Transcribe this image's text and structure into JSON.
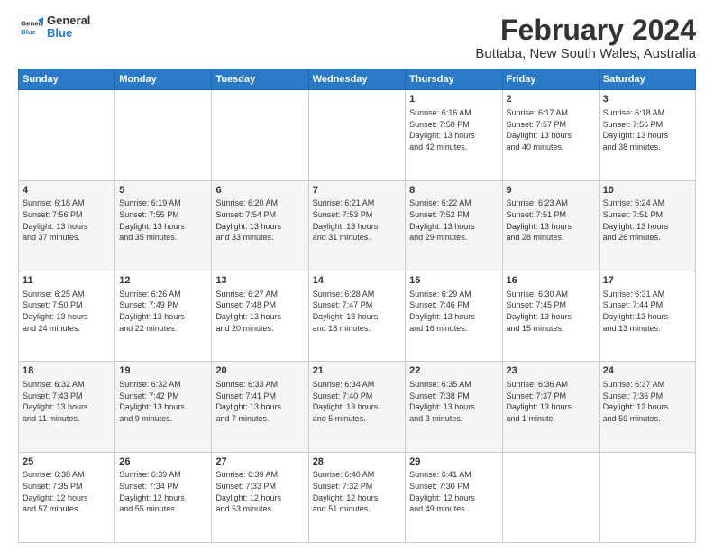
{
  "header": {
    "logo_line1": "General",
    "logo_line2": "Blue",
    "title": "February 2024",
    "subtitle": "Buttaba, New South Wales, Australia"
  },
  "days_of_week": [
    "Sunday",
    "Monday",
    "Tuesday",
    "Wednesday",
    "Thursday",
    "Friday",
    "Saturday"
  ],
  "weeks": [
    [
      {
        "day": "",
        "info": ""
      },
      {
        "day": "",
        "info": ""
      },
      {
        "day": "",
        "info": ""
      },
      {
        "day": "",
        "info": ""
      },
      {
        "day": "1",
        "info": "Sunrise: 6:16 AM\nSunset: 7:58 PM\nDaylight: 13 hours\nand 42 minutes."
      },
      {
        "day": "2",
        "info": "Sunrise: 6:17 AM\nSunset: 7:57 PM\nDaylight: 13 hours\nand 40 minutes."
      },
      {
        "day": "3",
        "info": "Sunrise: 6:18 AM\nSunset: 7:56 PM\nDaylight: 13 hours\nand 38 minutes."
      }
    ],
    [
      {
        "day": "4",
        "info": "Sunrise: 6:18 AM\nSunset: 7:56 PM\nDaylight: 13 hours\nand 37 minutes."
      },
      {
        "day": "5",
        "info": "Sunrise: 6:19 AM\nSunset: 7:55 PM\nDaylight: 13 hours\nand 35 minutes."
      },
      {
        "day": "6",
        "info": "Sunrise: 6:20 AM\nSunset: 7:54 PM\nDaylight: 13 hours\nand 33 minutes."
      },
      {
        "day": "7",
        "info": "Sunrise: 6:21 AM\nSunset: 7:53 PM\nDaylight: 13 hours\nand 31 minutes."
      },
      {
        "day": "8",
        "info": "Sunrise: 6:22 AM\nSunset: 7:52 PM\nDaylight: 13 hours\nand 29 minutes."
      },
      {
        "day": "9",
        "info": "Sunrise: 6:23 AM\nSunset: 7:51 PM\nDaylight: 13 hours\nand 28 minutes."
      },
      {
        "day": "10",
        "info": "Sunrise: 6:24 AM\nSunset: 7:51 PM\nDaylight: 13 hours\nand 26 minutes."
      }
    ],
    [
      {
        "day": "11",
        "info": "Sunrise: 6:25 AM\nSunset: 7:50 PM\nDaylight: 13 hours\nand 24 minutes."
      },
      {
        "day": "12",
        "info": "Sunrise: 6:26 AM\nSunset: 7:49 PM\nDaylight: 13 hours\nand 22 minutes."
      },
      {
        "day": "13",
        "info": "Sunrise: 6:27 AM\nSunset: 7:48 PM\nDaylight: 13 hours\nand 20 minutes."
      },
      {
        "day": "14",
        "info": "Sunrise: 6:28 AM\nSunset: 7:47 PM\nDaylight: 13 hours\nand 18 minutes."
      },
      {
        "day": "15",
        "info": "Sunrise: 6:29 AM\nSunset: 7:46 PM\nDaylight: 13 hours\nand 16 minutes."
      },
      {
        "day": "16",
        "info": "Sunrise: 6:30 AM\nSunset: 7:45 PM\nDaylight: 13 hours\nand 15 minutes."
      },
      {
        "day": "17",
        "info": "Sunrise: 6:31 AM\nSunset: 7:44 PM\nDaylight: 13 hours\nand 13 minutes."
      }
    ],
    [
      {
        "day": "18",
        "info": "Sunrise: 6:32 AM\nSunset: 7:43 PM\nDaylight: 13 hours\nand 11 minutes."
      },
      {
        "day": "19",
        "info": "Sunrise: 6:32 AM\nSunset: 7:42 PM\nDaylight: 13 hours\nand 9 minutes."
      },
      {
        "day": "20",
        "info": "Sunrise: 6:33 AM\nSunset: 7:41 PM\nDaylight: 13 hours\nand 7 minutes."
      },
      {
        "day": "21",
        "info": "Sunrise: 6:34 AM\nSunset: 7:40 PM\nDaylight: 13 hours\nand 5 minutes."
      },
      {
        "day": "22",
        "info": "Sunrise: 6:35 AM\nSunset: 7:38 PM\nDaylight: 13 hours\nand 3 minutes."
      },
      {
        "day": "23",
        "info": "Sunrise: 6:36 AM\nSunset: 7:37 PM\nDaylight: 13 hours\nand 1 minute."
      },
      {
        "day": "24",
        "info": "Sunrise: 6:37 AM\nSunset: 7:36 PM\nDaylight: 12 hours\nand 59 minutes."
      }
    ],
    [
      {
        "day": "25",
        "info": "Sunrise: 6:38 AM\nSunset: 7:35 PM\nDaylight: 12 hours\nand 57 minutes."
      },
      {
        "day": "26",
        "info": "Sunrise: 6:39 AM\nSunset: 7:34 PM\nDaylight: 12 hours\nand 55 minutes."
      },
      {
        "day": "27",
        "info": "Sunrise: 6:39 AM\nSunset: 7:33 PM\nDaylight: 12 hours\nand 53 minutes."
      },
      {
        "day": "28",
        "info": "Sunrise: 6:40 AM\nSunset: 7:32 PM\nDaylight: 12 hours\nand 51 minutes."
      },
      {
        "day": "29",
        "info": "Sunrise: 6:41 AM\nSunset: 7:30 PM\nDaylight: 12 hours\nand 49 minutes."
      },
      {
        "day": "",
        "info": ""
      },
      {
        "day": "",
        "info": ""
      }
    ]
  ]
}
